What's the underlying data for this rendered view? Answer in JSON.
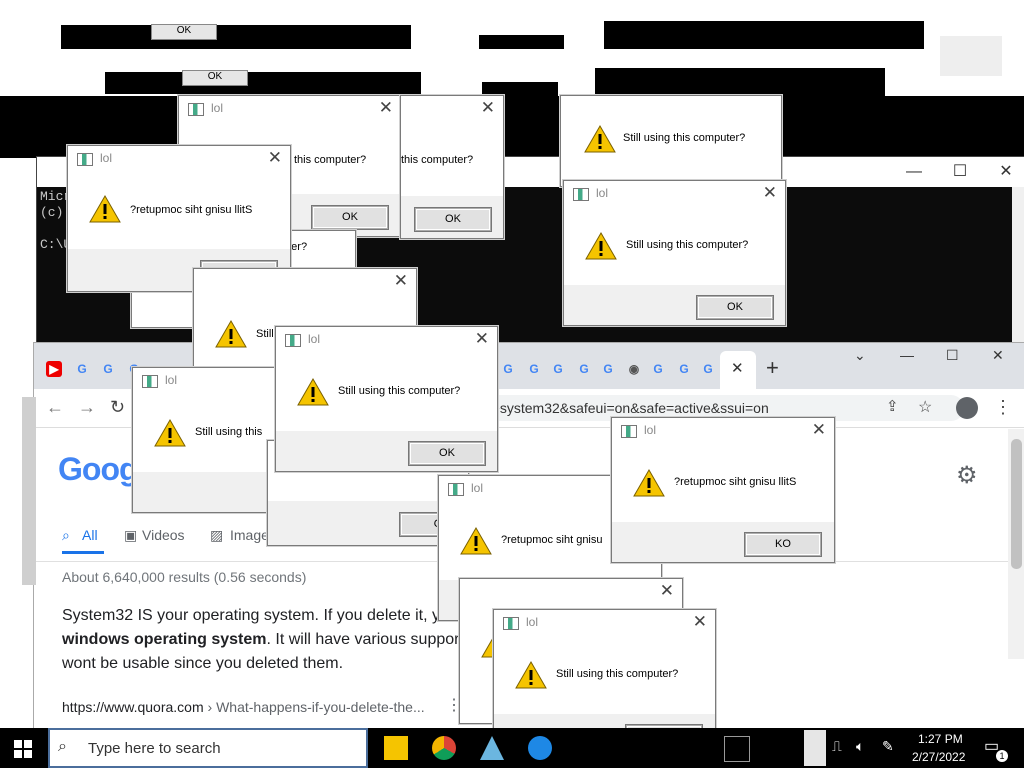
{
  "dialog_title": "lol",
  "dialog_message": "Still using this computer?",
  "dialog_message_reversed": "?retupmoc siht gnisu llitS",
  "ok_label": "OK",
  "ok_label_reversed": "KO",
  "partial": {
    "this_computer": "this computer?",
    "still": "Still",
    "still_using_this": "Still using this",
    "reversed_cut": "?retupmoc siht gnisu",
    "uter": "uter?",
    "o_btn": "O"
  },
  "console": {
    "line1": "Micr",
    "line2": "(c)",
    "line3": "C:\\U"
  },
  "chrome": {
    "url": "te+system32&safeui=on&safe=active&ssui=on",
    "tabs": {
      "all": "All",
      "videos": "Videos",
      "images": "Image"
    },
    "results_count": "About 6,640,000 results (0.56 seconds)",
    "snippet_a": "System32 IS your operating system. If you delete it, yo",
    "snippet_b_bold": "windows operating system",
    "snippet_b_rest": ". It will have various suppor",
    "snippet_c": "wont be usable since you deleted them.",
    "cite": "https://www.quora.com",
    "cite_path": " › What-happens-if-you-delete-the...",
    "logo": "Googl"
  },
  "taskbar": {
    "search_placeholder": "Type here to search",
    "time": "1:27 PM",
    "date": "2/27/2022",
    "notification_count": "1"
  },
  "colors": {
    "warning": "#f5c400",
    "chrome_blue": "#1a73e8"
  }
}
